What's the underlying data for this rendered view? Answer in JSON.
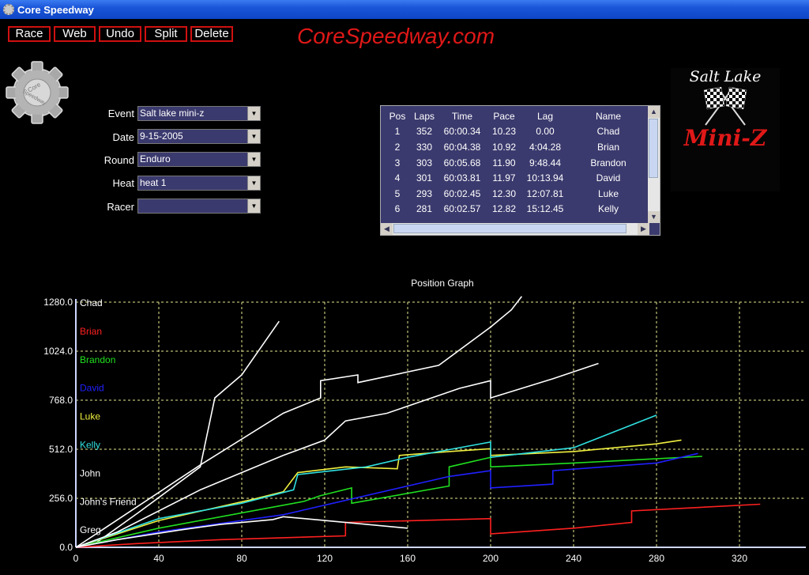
{
  "window": {
    "title": "Core Speedway"
  },
  "toolbar": {
    "buttons": [
      {
        "label": "Race"
      },
      {
        "label": "Web"
      },
      {
        "label": "Undo"
      },
      {
        "label": "Split"
      },
      {
        "label": "Delete"
      }
    ]
  },
  "site_title": "CoreSpeedway.com",
  "gear_logo_text": "Core Speedway",
  "form": {
    "event": {
      "label": "Event",
      "value": "Salt lake mini-z"
    },
    "date": {
      "label": "Date",
      "value": "9-15-2005"
    },
    "round": {
      "label": "Round",
      "value": "Enduro"
    },
    "heat": {
      "label": "Heat",
      "value": "heat 1"
    },
    "racer": {
      "label": "Racer",
      "value": ""
    }
  },
  "results": {
    "headers": [
      "Pos",
      "Laps",
      "Time",
      "Pace",
      "Lag",
      "Name"
    ],
    "rows": [
      [
        "1",
        "352",
        "60:00.34",
        "10.23",
        "0.00",
        "Chad"
      ],
      [
        "2",
        "330",
        "60:04.38",
        "10.92",
        "4:04.28",
        "Brian"
      ],
      [
        "3",
        "303",
        "60:05.68",
        "11.90",
        "9:48.44",
        "Brandon"
      ],
      [
        "4",
        "301",
        "60:03.81",
        "11.97",
        "10:13.94",
        "David"
      ],
      [
        "5",
        "293",
        "60:02.45",
        "12.30",
        "12:07.81",
        "Luke"
      ],
      [
        "6",
        "281",
        "60:02.57",
        "12.82",
        "15:12.45",
        "Kelly"
      ]
    ]
  },
  "logo": {
    "top": "Salt Lake",
    "bottom": "Mini-Z"
  },
  "icons": {
    "app": "gear-icon",
    "dropdown": "chevron-down-icon",
    "scroll_up": "arrow-up-icon",
    "scroll_down": "arrow-down-icon",
    "scroll_left": "arrow-left-icon",
    "scroll_right": "arrow-right-icon",
    "logo": "checkered-flags-icon"
  },
  "colors": {
    "background": "#000000",
    "accent_red": "#e01818",
    "select_bg": "#3b3a6e",
    "grid": "#e8e890",
    "titlebar": "#1a55d9"
  },
  "chart_data": {
    "type": "line",
    "title": "Position Graph",
    "xlim": [
      0,
      352
    ],
    "ylim": [
      0,
      1280
    ],
    "x_ticks": [
      "0",
      "40",
      "80",
      "120",
      "160",
      "200",
      "240",
      "280",
      "320"
    ],
    "y_ticks": [
      "0.0",
      "256.0",
      "512.0",
      "768.0",
      "1024.0",
      "1280.0"
    ],
    "grid": true,
    "legend_position": "left",
    "series": [
      {
        "name": "Chad",
        "color": "#ffffff",
        "points": [
          [
            0,
            0
          ],
          [
            10,
            25
          ],
          [
            30,
            180
          ],
          [
            60,
            420
          ],
          [
            67,
            780
          ],
          [
            80,
            900
          ],
          [
            98,
            1180
          ]
        ]
      },
      {
        "name": "Brian",
        "color": "#ff2020",
        "points": [
          [
            0,
            0
          ],
          [
            30,
            20
          ],
          [
            70,
            40
          ],
          [
            130,
            60
          ],
          [
            130,
            130
          ],
          [
            200,
            150
          ],
          [
            200,
            70
          ],
          [
            240,
            100
          ],
          [
            268,
            130
          ],
          [
            268,
            190
          ],
          [
            330,
            225
          ]
        ]
      },
      {
        "name": "Brandon",
        "color": "#20e020",
        "points": [
          [
            0,
            0
          ],
          [
            40,
            100
          ],
          [
            110,
            240
          ],
          [
            118,
            270
          ],
          [
            133,
            310
          ],
          [
            133,
            230
          ],
          [
            180,
            320
          ],
          [
            180,
            420
          ],
          [
            200,
            470
          ],
          [
            200,
            420
          ],
          [
            240,
            440
          ],
          [
            302,
            475
          ]
        ]
      },
      {
        "name": "David",
        "color": "#2020ff",
        "points": [
          [
            0,
            0
          ],
          [
            40,
            80
          ],
          [
            100,
            170
          ],
          [
            180,
            370
          ],
          [
            200,
            400
          ],
          [
            200,
            310
          ],
          [
            230,
            330
          ],
          [
            230,
            400
          ],
          [
            280,
            440
          ],
          [
            300,
            490
          ]
        ]
      },
      {
        "name": "Luke",
        "color": "#f0f040",
        "points": [
          [
            0,
            0
          ],
          [
            40,
            140
          ],
          [
            85,
            250
          ],
          [
            100,
            290
          ],
          [
            107,
            390
          ],
          [
            130,
            420
          ],
          [
            155,
            410
          ],
          [
            156,
            480
          ],
          [
            180,
            500
          ],
          [
            200,
            515
          ],
          [
            200,
            480
          ],
          [
            240,
            500
          ],
          [
            280,
            540
          ],
          [
            292,
            560
          ]
        ]
      },
      {
        "name": "Kelly",
        "color": "#30e0e0",
        "points": [
          [
            0,
            0
          ],
          [
            40,
            150
          ],
          [
            80,
            230
          ],
          [
            105,
            300
          ],
          [
            107,
            380
          ],
          [
            140,
            420
          ],
          [
            160,
            470
          ],
          [
            190,
            530
          ],
          [
            200,
            550
          ],
          [
            200,
            470
          ],
          [
            240,
            520
          ],
          [
            280,
            690
          ]
        ]
      },
      {
        "name": "John",
        "color": "#ffffff",
        "points": [
          [
            0,
            0
          ],
          [
            20,
            80
          ],
          [
            60,
            300
          ],
          [
            80,
            390
          ],
          [
            100,
            480
          ],
          [
            120,
            560
          ],
          [
            130,
            660
          ],
          [
            150,
            700
          ],
          [
            185,
            830
          ],
          [
            200,
            870
          ],
          [
            200,
            780
          ],
          [
            230,
            880
          ],
          [
            252,
            960
          ]
        ]
      },
      {
        "name": "John's Friend",
        "color": "#ffffff",
        "points": [
          [
            0,
            0
          ],
          [
            60,
            430
          ],
          [
            100,
            700
          ],
          [
            118,
            780
          ],
          [
            118,
            870
          ],
          [
            136,
            900
          ],
          [
            136,
            860
          ],
          [
            175,
            950
          ],
          [
            200,
            1150
          ],
          [
            210,
            1240
          ],
          [
            215,
            1310
          ]
        ]
      },
      {
        "name": "Greg",
        "color": "#ffffff",
        "points": [
          [
            0,
            0
          ],
          [
            20,
            40
          ],
          [
            50,
            90
          ],
          [
            70,
            120
          ],
          [
            95,
            145
          ],
          [
            100,
            160
          ],
          [
            120,
            140
          ],
          [
            140,
            120
          ],
          [
            160,
            100
          ]
        ]
      }
    ]
  }
}
